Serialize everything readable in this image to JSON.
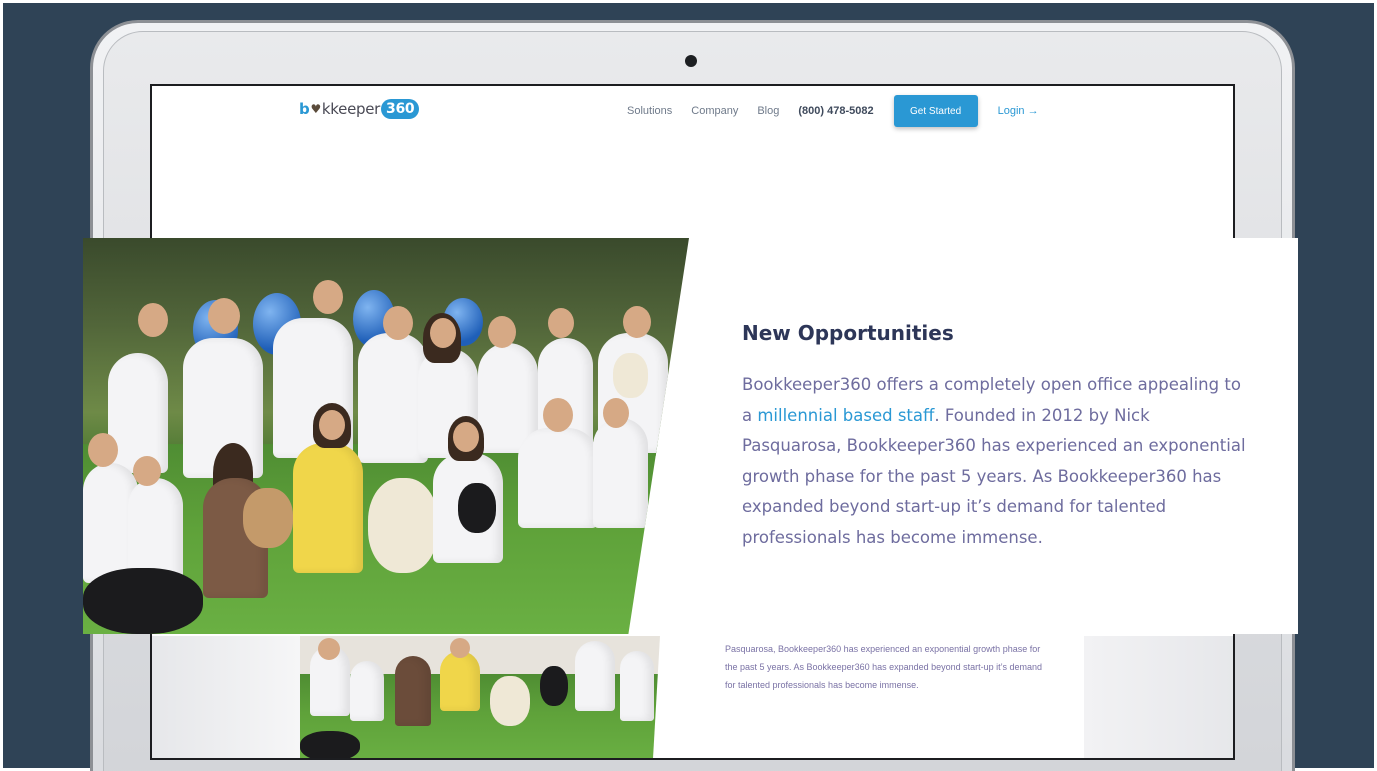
{
  "nav": {
    "logo_prefix": "b",
    "logo_heart": "♥",
    "logo_mid": "kkeeper",
    "logo_num": "360",
    "links": [
      "Solutions",
      "Company",
      "Blog"
    ],
    "phone": "(800) 478-5082",
    "cta": "Get Started",
    "login": "Login →"
  },
  "hero": {
    "title": "New Opportunities",
    "body_start": "Bookkeeper360 offers a completely open office appealing to a ",
    "body_link": "millennial based staff",
    "body_end": ". Founded in 2012 by Nick Pasquarosa, Bookkeeper360 has experienced an exponential growth phase for the past 5 years. As Bookkeeper360 has expanded beyond start-up it’s demand for talented professionals has become immense."
  },
  "lower": {
    "text": "Pasquarosa, Bookkeeper360 has experienced an exponential growth phase for the past 5 years. As Bookkeeper360 has expanded beyond start-up it’s demand for talented professionals has become immense."
  },
  "colors": {
    "background": "#2f4356",
    "accent": "#2a98d4",
    "title": "#2d3658",
    "body": "#6e6c9e"
  }
}
